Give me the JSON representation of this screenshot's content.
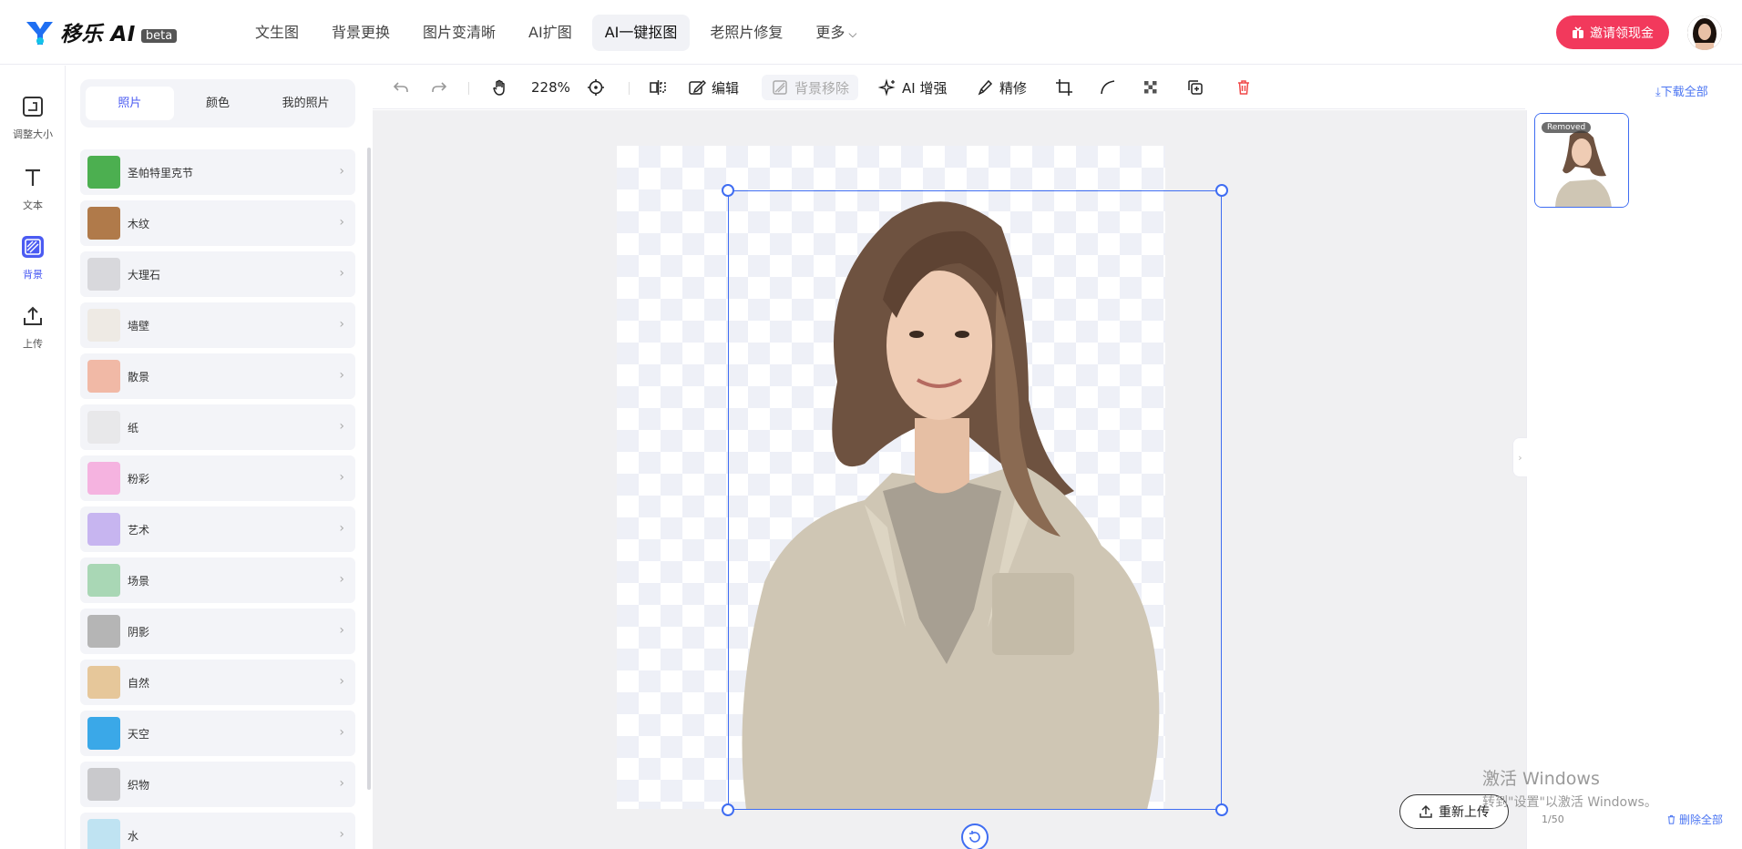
{
  "brand": {
    "name": "移乐 AI",
    "badge": "beta",
    "accent": "#4b5bf2",
    "invite_color": "#f2395c"
  },
  "nav": {
    "items": [
      {
        "label": "文生图"
      },
      {
        "label": "背景更换"
      },
      {
        "label": "图片变清晰"
      },
      {
        "label": "AI扩图"
      },
      {
        "label": "AI一键抠图",
        "active": true
      },
      {
        "label": "老照片修复"
      },
      {
        "label": "更多"
      }
    ]
  },
  "header": {
    "invite_label": "邀请领现金"
  },
  "rail": {
    "items": [
      {
        "label": "调整大小",
        "icon": "resize-icon"
      },
      {
        "label": "文本",
        "icon": "text-icon"
      },
      {
        "label": "背景",
        "icon": "background-icon",
        "active": true
      },
      {
        "label": "上传",
        "icon": "upload-icon"
      }
    ]
  },
  "panel": {
    "tabs": [
      {
        "label": "照片",
        "active": true
      },
      {
        "label": "颜色"
      },
      {
        "label": "我的照片"
      }
    ],
    "backgrounds": [
      {
        "label": "圣帕特里克节",
        "color": "#4caf50"
      },
      {
        "label": "木纹",
        "color": "#b07a4a"
      },
      {
        "label": "大理石",
        "color": "#d8d8dc"
      },
      {
        "label": "墙壁",
        "color": "#eeeae4"
      },
      {
        "label": "散景",
        "color": "#f1b9a6"
      },
      {
        "label": "纸",
        "color": "#e8e8ea"
      },
      {
        "label": "粉彩",
        "color": "#f5b3e0"
      },
      {
        "label": "艺术",
        "color": "#c7b5f0"
      },
      {
        "label": "场景",
        "color": "#a9d7b5"
      },
      {
        "label": "阴影",
        "color": "#b5b5b5"
      },
      {
        "label": "自然",
        "color": "#e6c79a"
      },
      {
        "label": "天空",
        "color": "#3aa8e8"
      },
      {
        "label": "织物",
        "color": "#c9c9cc"
      },
      {
        "label": "水",
        "color": "#bfe3f2"
      }
    ]
  },
  "toolbar": {
    "zoom": "228%",
    "edit_label": "编辑",
    "bg_remove_label": "背景移除",
    "ai_enhance_label": "AI 增强",
    "refine_label": "精修",
    "download_all_label": "下载全部"
  },
  "canvas": {
    "reupload_label": "重新上传"
  },
  "right": {
    "removed_tag": "Removed",
    "count": "1/50",
    "delete_all_label": "删除全部"
  },
  "watermark": {
    "line1": "激活 Windows",
    "line2": "转到\"设置\"以激活 Windows。"
  }
}
